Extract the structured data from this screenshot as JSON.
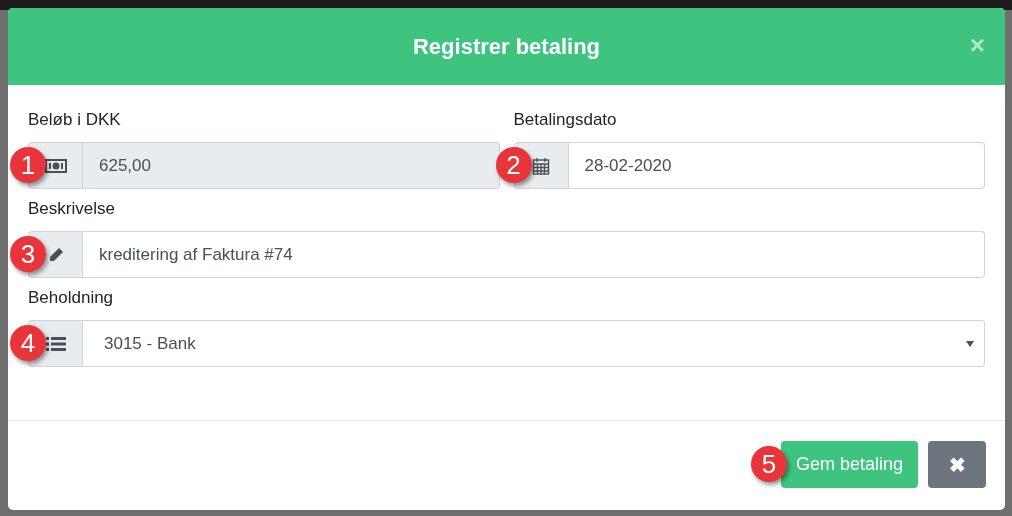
{
  "dialog": {
    "title": "Registrer betaling",
    "close": "×"
  },
  "fields": [
    {
      "kind": "money",
      "label": "Beløb i DKK",
      "value": "625,00",
      "disabled": true,
      "marker": "1"
    },
    {
      "kind": "date",
      "label": "Betalingsdato",
      "value": "28-02-2020",
      "disabled": false,
      "marker": "2"
    },
    {
      "kind": "text",
      "label": "Beskrivelse",
      "value": "kreditering af Faktura #74",
      "disabled": false,
      "marker": "3"
    },
    {
      "kind": "select",
      "label": "Beholdning",
      "value": "3015 - Bank",
      "disabled": false,
      "marker": "4"
    }
  ],
  "buttons": [
    {
      "kind": "primary",
      "label": "Gem betaling",
      "marker": "5"
    },
    {
      "kind": "cancel",
      "label": "✖"
    }
  ]
}
